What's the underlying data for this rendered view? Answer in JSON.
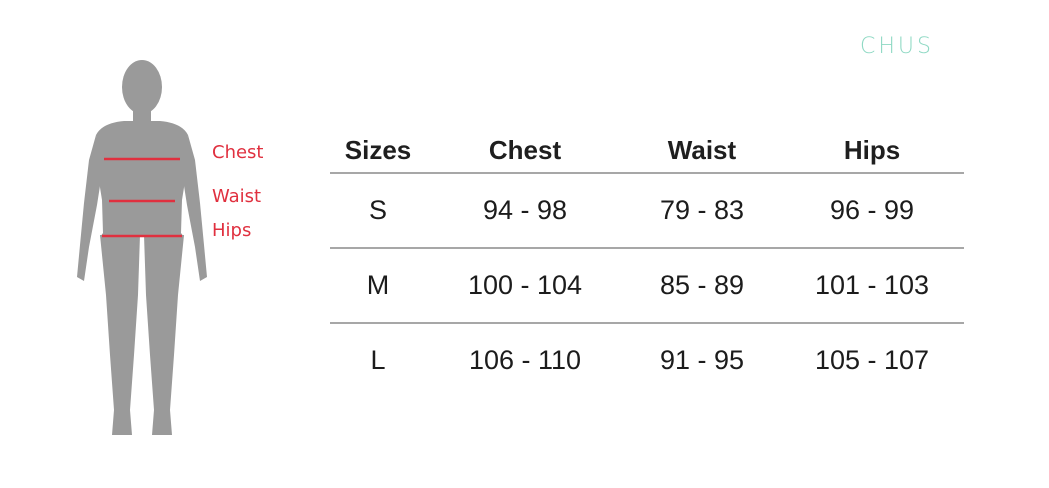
{
  "brand": {
    "logo_text": "CHUS"
  },
  "figure": {
    "labels": {
      "chest": "Chest",
      "waist": "Waist",
      "hips": "Hips"
    },
    "line_color": "#e0303f",
    "body_color": "#9a9a9a"
  },
  "table": {
    "headers": [
      "Sizes",
      "Chest",
      "Waist",
      "Hips"
    ],
    "rows": [
      [
        "S",
        "94 - 98",
        "79 - 83",
        "96 - 99"
      ],
      [
        "M",
        "100 - 104",
        "85 - 89",
        "101 - 103"
      ],
      [
        "L",
        "106 - 110",
        "91 - 95",
        "105 - 107"
      ]
    ]
  }
}
